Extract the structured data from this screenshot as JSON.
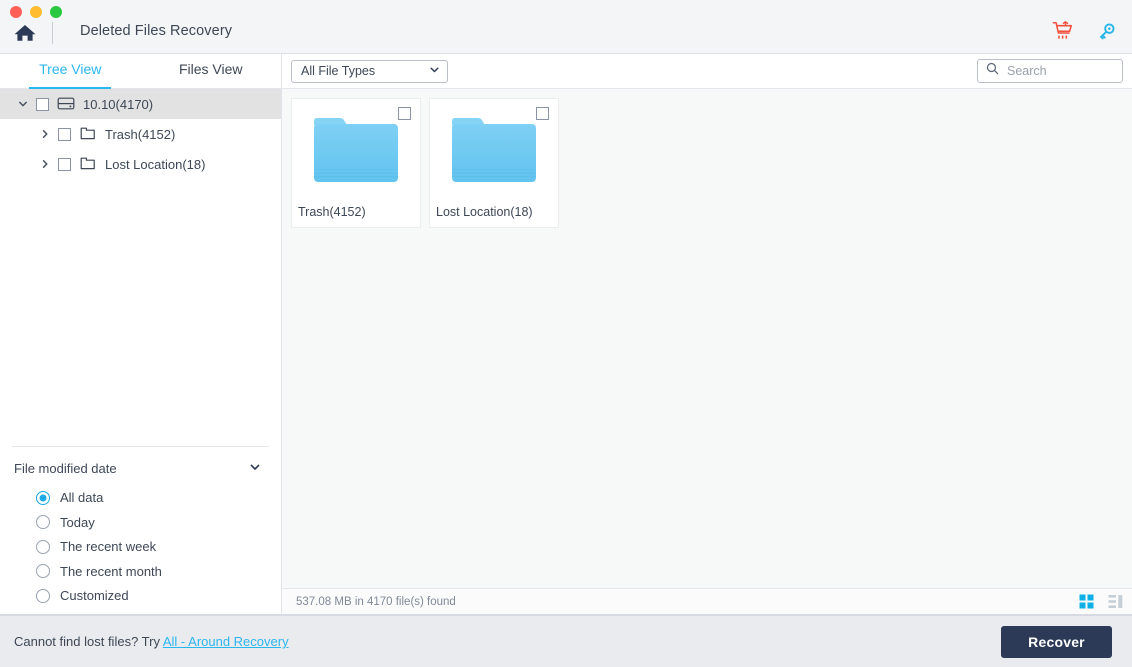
{
  "window": {
    "title": "Deleted Files Recovery",
    "controls": [
      "close",
      "minimize",
      "maximize"
    ],
    "home_icon": "home-icon",
    "toolbar_icons": [
      {
        "name": "cart-icon",
        "color": "#f4503c"
      },
      {
        "name": "key-icon",
        "color": "#29b6e8"
      }
    ]
  },
  "sidebar": {
    "tabs": [
      {
        "label": "Tree View",
        "active": true
      },
      {
        "label": "Files View",
        "active": false
      }
    ],
    "tree": [
      {
        "label": "10.10(4170)",
        "level": 0,
        "icon": "disk-icon",
        "expanded": true,
        "checked": false,
        "selected": true
      },
      {
        "label": "Trash(4152)",
        "level": 1,
        "icon": "folder-outline-icon",
        "expanded": false,
        "checked": false,
        "selected": false
      },
      {
        "label": "Lost Location(18)",
        "level": 1,
        "icon": "folder-outline-icon",
        "expanded": false,
        "checked": false,
        "selected": false
      }
    ],
    "filter": {
      "title": "File modified date",
      "collapsed": false,
      "options": [
        {
          "label": "All data",
          "selected": true
        },
        {
          "label": "Today",
          "selected": false
        },
        {
          "label": "The recent week",
          "selected": false
        },
        {
          "label": "The recent month",
          "selected": false
        },
        {
          "label": "Customized",
          "selected": false
        }
      ]
    }
  },
  "toolbar": {
    "file_type_filter": "All File Types",
    "search_placeholder": "Search",
    "search_value": ""
  },
  "content": {
    "items": [
      {
        "label": "Trash(4152)",
        "icon": "folder-icon",
        "checked": false
      },
      {
        "label": "Lost Location(18)",
        "icon": "folder-icon",
        "checked": false
      }
    ]
  },
  "statusbar": {
    "text": "537.08 MB in 4170 file(s) found",
    "view_modes": [
      {
        "name": "grid-view-icon",
        "active": true
      },
      {
        "name": "list-view-icon",
        "active": false
      }
    ]
  },
  "footer": {
    "text_prefix": "Cannot find lost files? Try ",
    "link_label": "All - Around Recovery",
    "recover_label": "Recover"
  },
  "colors": {
    "accent": "#2ab6ef",
    "folder": "#6fc9f2",
    "recover_bg": "#2c3a57",
    "cart": "#f4503c",
    "key": "#29b6e8",
    "text": "#3d4756"
  }
}
